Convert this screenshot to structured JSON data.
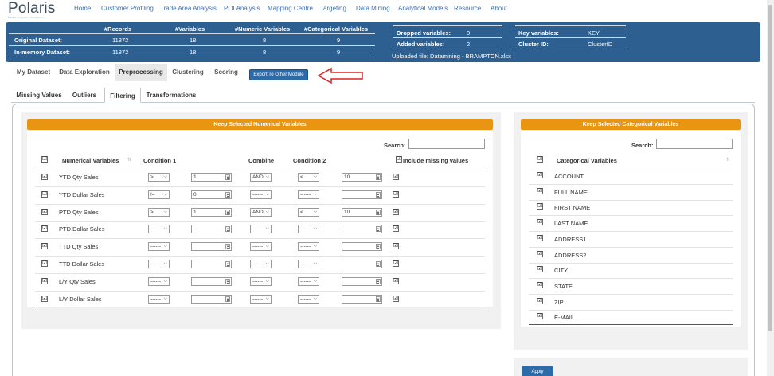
{
  "logo": {
    "wordmark": "Polaris",
    "tagline": "Market Analytics • Intelligence"
  },
  "nav": [
    "Home",
    "Customer Profiling",
    "Trade Area Analysis",
    "POI Analysis",
    "Mapping Centre",
    "Targeting",
    "Data Mining",
    "Analytical Models",
    "Resource",
    "About"
  ],
  "dataset": {
    "headers": [
      "#Records",
      "#Variables",
      "#Numeric Variables",
      "#Categorical Variables"
    ],
    "rows": [
      {
        "label": "Original Dataset:",
        "values": [
          "11872",
          "18",
          "8",
          "9"
        ]
      },
      {
        "label": "In-memory Dataset:",
        "values": [
          "11872",
          "18",
          "8",
          "9"
        ]
      }
    ],
    "dropped_label": "Dropped variables:",
    "dropped_value": "0",
    "added_label": "Added variables:",
    "added_value": "2",
    "uploaded": "Uploaded file: Datamining - BRAMPTON.xlsx",
    "key_label": "Key variables:",
    "key_value": "KEY",
    "cluster_label": "Cluster ID:",
    "cluster_value": "ClusterID"
  },
  "module_tabs": [
    "My Dataset",
    "Data Exploration",
    "Preprocessing",
    "Clustering",
    "Scoring"
  ],
  "export_button": "Export To Other Module",
  "sub_tabs": [
    "Missing Values",
    "Outliers",
    "Filtering",
    "Transformations"
  ],
  "numerical": {
    "title": "Keep Selected Numerical Variables",
    "search_label": "Search:",
    "headers": {
      "variable": "Numerical Variables",
      "cond1": "Condition 1",
      "combine": "Combine",
      "cond2": "Condition 2",
      "include": "Include missing values"
    },
    "rows": [
      {
        "name": "YTD Qty Sales",
        "op1": ">",
        "val1": "1",
        "combine": "AND",
        "op2": "<",
        "val2": "10"
      },
      {
        "name": "YTD Dollar Sales",
        "op1": "!=",
        "val1": "0",
        "combine": "------",
        "op2": "------",
        "val2": ""
      },
      {
        "name": "PTD Qty Sales",
        "op1": ">",
        "val1": "1",
        "combine": "AND",
        "op2": "<",
        "val2": "10"
      },
      {
        "name": "PTD Dollar Sales",
        "op1": "------",
        "val1": "",
        "combine": "------",
        "op2": "------",
        "val2": ""
      },
      {
        "name": "TTD Qty Sales",
        "op1": "------",
        "val1": "",
        "combine": "------",
        "op2": "------",
        "val2": ""
      },
      {
        "name": "TTD Dollar Sales",
        "op1": "------",
        "val1": "",
        "combine": "------",
        "op2": "------",
        "val2": ""
      },
      {
        "name": "L/Y Qty Sales",
        "op1": "------",
        "val1": "",
        "combine": "------",
        "op2": "------",
        "val2": ""
      },
      {
        "name": "L/Y Dollar Sales",
        "op1": "------",
        "val1": "",
        "combine": "------",
        "op2": "------",
        "val2": ""
      }
    ]
  },
  "categorical": {
    "title": "Keep Selected Categorical Variables",
    "search_label": "Search:",
    "header": "Categorical Variables",
    "rows": [
      "ACCOUNT",
      "FULL NAME",
      "FIRST NAME",
      "LAST NAME",
      "ADDRESS1",
      "ADDRESS2",
      "CITY",
      "STATE",
      "ZIP",
      "E-MAIL"
    ]
  },
  "apply_button": "Apply",
  "check_glyph": "☑",
  "colors": {
    "banner": "#2d5f91",
    "accent": "#ea9512",
    "button": "#2d6aa8",
    "link": "#3d6fb0"
  }
}
